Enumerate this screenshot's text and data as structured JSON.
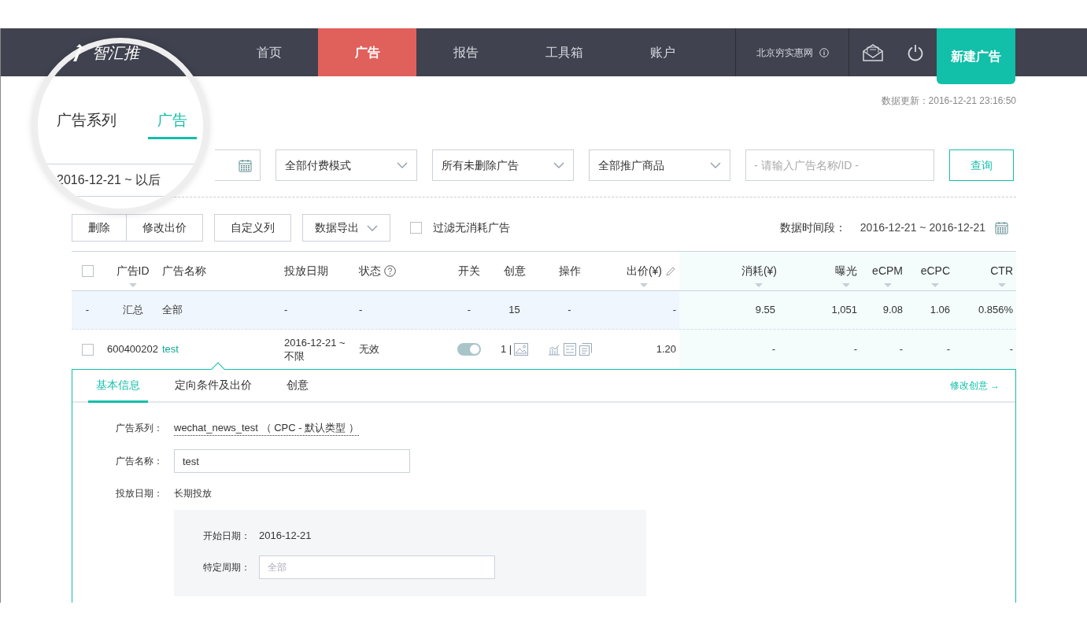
{
  "nav": {
    "logo": "智汇推",
    "items": [
      {
        "label": "首页",
        "selected": false
      },
      {
        "label": "广告",
        "selected": true
      },
      {
        "label": "报告",
        "selected": false
      },
      {
        "label": "工具箱",
        "selected": false
      },
      {
        "label": "账户",
        "selected": false
      }
    ],
    "account": "北京穷实惠网",
    "new_button": "新建广告"
  },
  "update_time": "数据更新：2016-12-21 23:16:50",
  "magnifier": {
    "tabs": [
      {
        "label": "广告系列",
        "selected": false
      },
      {
        "label": "广告",
        "selected": true
      }
    ],
    "date_value": "2016-12-21 ~ 以后"
  },
  "filters": {
    "selects": [
      "全部付费模式",
      "所有未删除广告",
      "全部推广商品"
    ],
    "search_placeholder": "- 请输入广告名称/ID -",
    "query_button": "查询"
  },
  "toolbar": {
    "buttons": [
      "删除",
      "修改出价",
      "自定义列"
    ],
    "export_button": "数据导出",
    "filter_checkbox": {
      "label": "过滤无消耗广告",
      "checked": false
    },
    "period_label": "数据时间段：",
    "period": "2016-12-21 ~ 2016-12-21"
  },
  "table": {
    "select_all": {
      "checked": false
    },
    "columns": [
      {
        "label": "广告ID",
        "sortable": true
      },
      {
        "label": "广告名称",
        "sortable": false
      },
      {
        "label": "投放日期",
        "sortable": false
      },
      {
        "label": "状态",
        "sortable": false
      },
      {
        "label": "开关",
        "sortable": false
      },
      {
        "label": "创意",
        "sortable": false
      },
      {
        "label": "操作",
        "sortable": false
      },
      {
        "label": "出价(¥)",
        "sortable": true
      },
      {
        "label": "消耗(¥)",
        "sortable": true
      },
      {
        "label": "曝光",
        "sortable": true
      },
      {
        "label": "eCPM",
        "sortable": true
      },
      {
        "label": "eCPC",
        "sortable": true
      },
      {
        "label": "CTR",
        "sortable": true
      }
    ],
    "summary": [
      "-",
      "汇总",
      "全部",
      "-",
      "-",
      "-",
      "15",
      "-",
      "-",
      "9.55",
      "1,051",
      "9.08",
      "1.06",
      "0.856%"
    ],
    "rows": [
      {
        "checked": false,
        "id": "600400202",
        "name": "test",
        "date": "2016-12-21 ~ 不限",
        "status": "无效",
        "on": true,
        "creatives": "1 |",
        "bid": "1.20",
        "metrics": [
          "-",
          "-",
          "-",
          "-",
          "-"
        ]
      }
    ]
  },
  "detail": {
    "tabs": [
      {
        "label": "基本信息",
        "selected": true
      },
      {
        "label": "定向条件及出价",
        "selected": false
      },
      {
        "label": "创意",
        "selected": false
      }
    ],
    "edit_link": "修改创意 →",
    "series_label": "广告系列：",
    "series_value": "wechat_news_test （ CPC - 默认类型 ）",
    "name_label": "广告名称：",
    "name_value": "test",
    "date_label": "投放日期：",
    "date_value": "长期投放",
    "start_label": "开始日期：",
    "start_value": "2016-12-21",
    "period_label": "特定周期：",
    "period_placeholder": "全部"
  }
}
